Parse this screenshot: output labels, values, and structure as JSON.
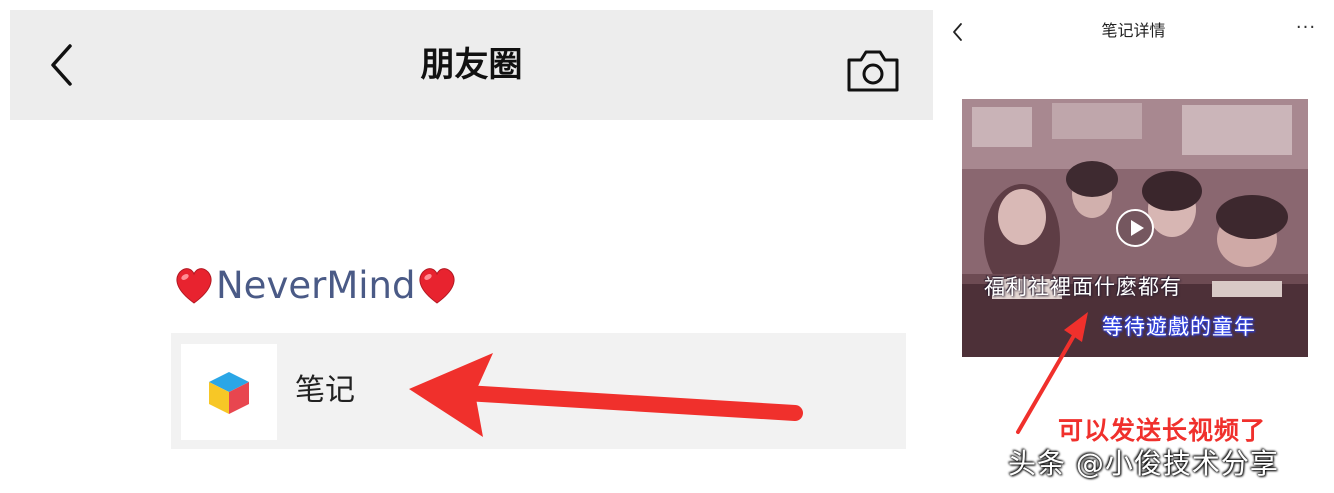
{
  "moments": {
    "title": "朋友圈",
    "author": "NeverMind",
    "note_label": "笔记"
  },
  "note_detail": {
    "title": "笔记详情",
    "more": "···",
    "video": {
      "subtitle_line1": "福利社裡面什麼都有",
      "subtitle_line2": "等待遊戲的童年"
    }
  },
  "annotation": {
    "caption": "可以发送长视频了"
  },
  "watermark": "头条 @小俊技术分享",
  "colors": {
    "topbar_bg": "#ededed",
    "author_color": "#4a5a86",
    "arrow_red": "#f0302c",
    "card_bg": "#f2f2f2"
  },
  "icons": [
    "back-chevron-icon",
    "camera-icon",
    "heart-emoji-icon",
    "note-cube-icon",
    "more-icon",
    "play-icon"
  ]
}
